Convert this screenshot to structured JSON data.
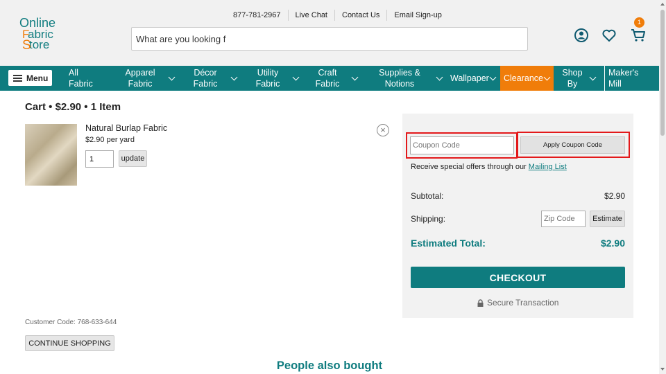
{
  "header": {
    "top_links": [
      "877-781-2967",
      "Live Chat",
      "Contact Us",
      "Email Sign-up"
    ],
    "search_value": "What are you looking f",
    "cart_count": "1",
    "icons": [
      "account-icon",
      "heart-icon",
      "cart-icon"
    ]
  },
  "nav": {
    "menu_label": "Menu",
    "items": [
      {
        "line1": "All",
        "line2": "Fabric"
      },
      {
        "line1": "Apparel",
        "line2": "Fabric"
      },
      {
        "line1": "Décor",
        "line2": "Fabric"
      },
      {
        "line1": "Utility",
        "line2": "Fabric"
      },
      {
        "line1": "Craft",
        "line2": "Fabric"
      },
      {
        "line1": "Supplies &",
        "line2": "Notions"
      },
      {
        "line1": "Wallpaper",
        "line2": ""
      },
      {
        "line1": "Clearance",
        "line2": ""
      },
      {
        "line1": "Shop",
        "line2": "By"
      },
      {
        "line1": "Maker's",
        "line2": "Mill"
      }
    ],
    "accent_color": "#0f7c7f",
    "clearance_color": "#f07d0a"
  },
  "cart": {
    "title": "Cart • $2.90 • 1 Item",
    "item": {
      "name": "Natural Burlap Fabric",
      "price": "$2.90 per yard",
      "quantity": "1",
      "update_label": "update"
    },
    "customer_code": "Customer Code: 768-633-644",
    "continue_label": "CONTINUE SHOPPING",
    "people_also_bought": "People also bought"
  },
  "summary": {
    "coupon_placeholder": "Coupon Code",
    "apply_label": "Apply Coupon Code",
    "offers_text": "Receive special offers through our ",
    "mailing_list": "Mailing List",
    "subtotal_label": "Subtotal:",
    "subtotal_value": "$2.90",
    "shipping_label": "Shipping:",
    "zip_placeholder": "Zip Code",
    "estimate_label": "Estimate",
    "total_label": "Estimated Total:",
    "total_value": "$2.90",
    "checkout_label": "CHECKOUT",
    "secure_label": "Secure Transaction"
  }
}
